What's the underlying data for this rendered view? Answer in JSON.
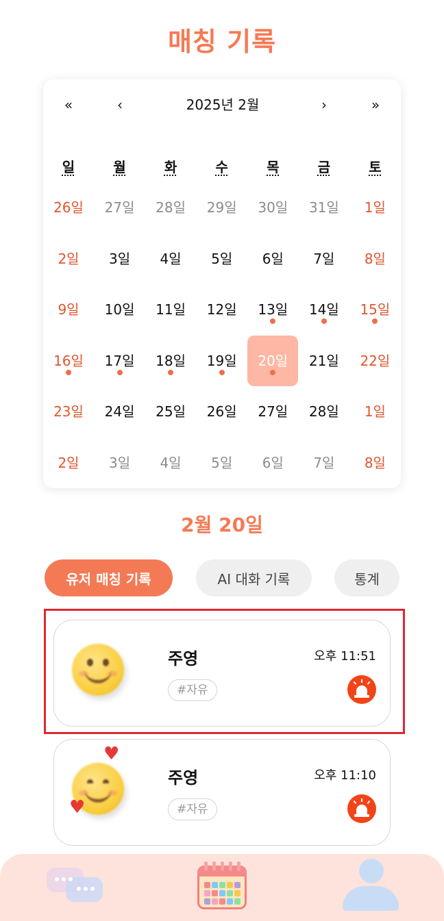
{
  "header": {
    "title": "매칭 기록"
  },
  "calendar": {
    "title": "2025년 2월",
    "nav": {
      "prev_year": "«",
      "prev_month": "‹",
      "next_month": "›",
      "next_year": "»"
    },
    "weekdays": [
      "일",
      "월",
      "화",
      "수",
      "목",
      "금",
      "토"
    ],
    "weeks": [
      [
        {
          "label": "26일",
          "kind": "sun",
          "dot": false
        },
        {
          "label": "27일",
          "kind": "other",
          "dot": false
        },
        {
          "label": "28일",
          "kind": "other",
          "dot": false
        },
        {
          "label": "29일",
          "kind": "other",
          "dot": false
        },
        {
          "label": "30일",
          "kind": "other",
          "dot": false
        },
        {
          "label": "31일",
          "kind": "other",
          "dot": false
        },
        {
          "label": "1일",
          "kind": "sat",
          "dot": false
        }
      ],
      [
        {
          "label": "2일",
          "kind": "sun",
          "dot": false
        },
        {
          "label": "3일",
          "kind": "cur",
          "dot": false
        },
        {
          "label": "4일",
          "kind": "cur",
          "dot": false
        },
        {
          "label": "5일",
          "kind": "cur",
          "dot": false
        },
        {
          "label": "6일",
          "kind": "cur",
          "dot": false
        },
        {
          "label": "7일",
          "kind": "cur",
          "dot": false
        },
        {
          "label": "8일",
          "kind": "sat",
          "dot": false
        }
      ],
      [
        {
          "label": "9일",
          "kind": "sun",
          "dot": false
        },
        {
          "label": "10일",
          "kind": "cur",
          "dot": false
        },
        {
          "label": "11일",
          "kind": "cur",
          "dot": false
        },
        {
          "label": "12일",
          "kind": "cur",
          "dot": false
        },
        {
          "label": "13일",
          "kind": "cur",
          "dot": true
        },
        {
          "label": "14일",
          "kind": "cur",
          "dot": true
        },
        {
          "label": "15일",
          "kind": "sat",
          "dot": true
        }
      ],
      [
        {
          "label": "16일",
          "kind": "sun",
          "dot": true
        },
        {
          "label": "17일",
          "kind": "cur",
          "dot": true
        },
        {
          "label": "18일",
          "kind": "cur",
          "dot": true
        },
        {
          "label": "19일",
          "kind": "cur",
          "dot": true
        },
        {
          "label": "20일",
          "kind": "selected",
          "dot": true
        },
        {
          "label": "21일",
          "kind": "cur",
          "dot": false
        },
        {
          "label": "22일",
          "kind": "sat",
          "dot": false
        }
      ],
      [
        {
          "label": "23일",
          "kind": "sun",
          "dot": false
        },
        {
          "label": "24일",
          "kind": "cur",
          "dot": false
        },
        {
          "label": "25일",
          "kind": "cur",
          "dot": false
        },
        {
          "label": "26일",
          "kind": "cur",
          "dot": false
        },
        {
          "label": "27일",
          "kind": "cur",
          "dot": false
        },
        {
          "label": "28일",
          "kind": "cur",
          "dot": false
        },
        {
          "label": "1일",
          "kind": "sat",
          "dot": false
        }
      ],
      [
        {
          "label": "2일",
          "kind": "sun",
          "dot": false
        },
        {
          "label": "3일",
          "kind": "other",
          "dot": false
        },
        {
          "label": "4일",
          "kind": "other",
          "dot": false
        },
        {
          "label": "5일",
          "kind": "other",
          "dot": false
        },
        {
          "label": "6일",
          "kind": "other",
          "dot": false
        },
        {
          "label": "7일",
          "kind": "other",
          "dot": false
        },
        {
          "label": "8일",
          "kind": "sat",
          "dot": false
        }
      ]
    ]
  },
  "selected_date": "2월 20일",
  "tabs": [
    {
      "label": "유저 매칭 기록",
      "active": true
    },
    {
      "label": "AI 대화 기록",
      "active": false
    },
    {
      "label": "통계",
      "active": false
    }
  ],
  "records": [
    {
      "name": "주영",
      "time": "오후 11:51",
      "tag": "#자유",
      "avatar": "smile-emoji",
      "highlighted": true
    },
    {
      "name": "주영",
      "time": "오후 11:10",
      "tag": "#자유",
      "avatar": "smiling-hearts-emoji",
      "highlighted": false
    }
  ],
  "bottom_nav": [
    {
      "icon": "chat-bubbles-icon"
    },
    {
      "icon": "calendar-icon"
    },
    {
      "icon": "user-profile-icon"
    }
  ],
  "colors": {
    "accent": "#f47a55",
    "weekend": "#e0562f",
    "other_month": "#8c8c8c",
    "selected_bg": "#fdb7a4",
    "dot": "#ef6f4d",
    "siren": "#f24417",
    "highlight_border": "#e0262e",
    "bottom_bar": "#fde3dc"
  }
}
